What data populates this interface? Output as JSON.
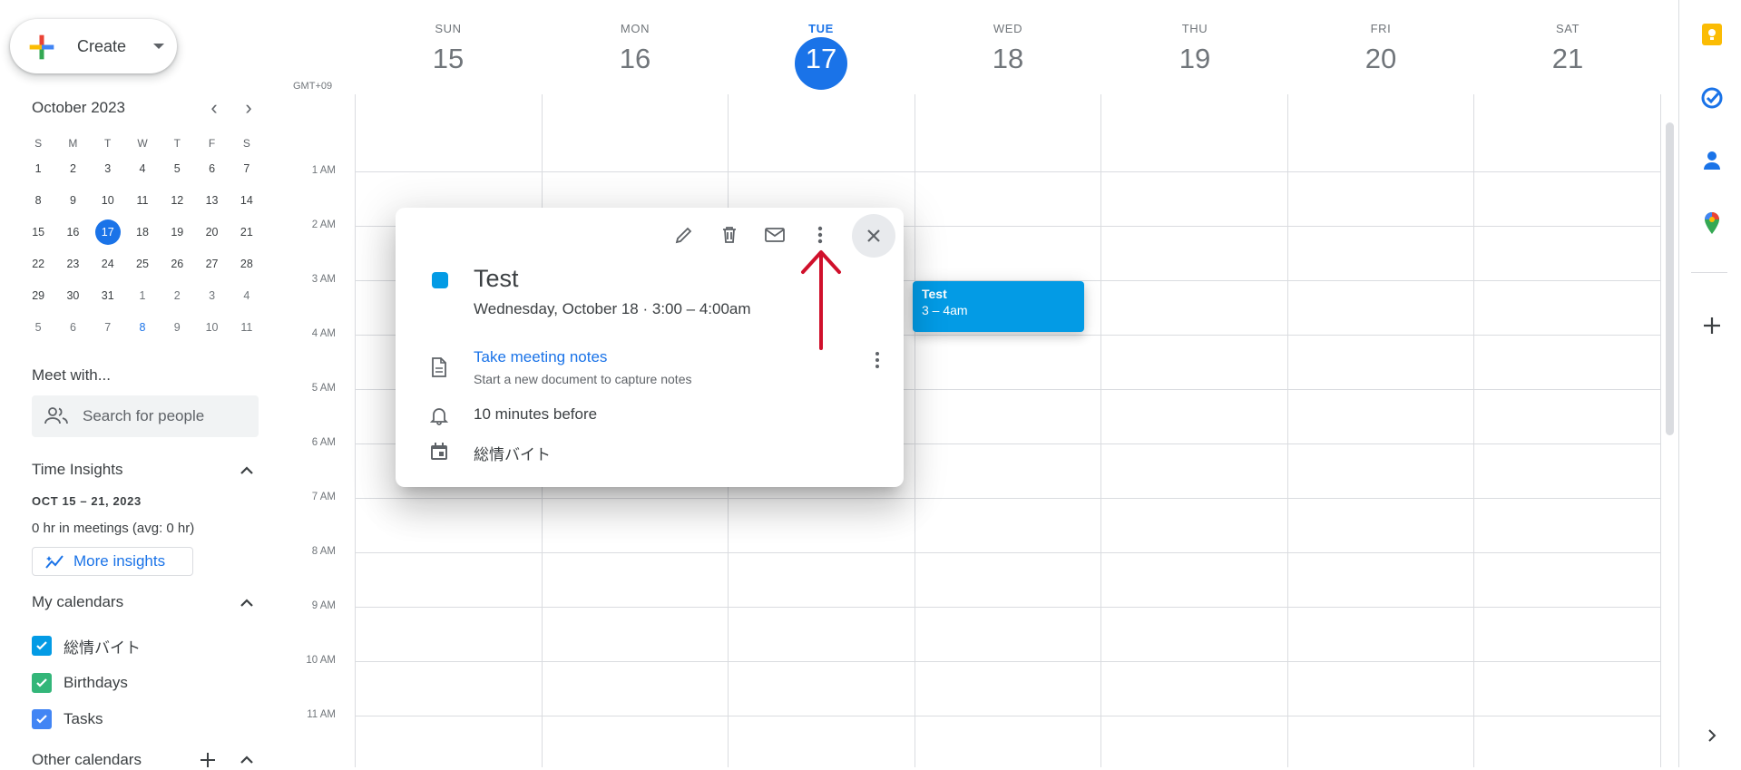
{
  "create_label": "Create",
  "mini": {
    "title": "October 2023",
    "weekdays": [
      "S",
      "M",
      "T",
      "W",
      "T",
      "F",
      "S"
    ],
    "weeks": [
      [
        "1",
        "2",
        "3",
        "4",
        "5",
        "6",
        "7"
      ],
      [
        "8",
        "9",
        "10",
        "11",
        "12",
        "13",
        "14"
      ],
      [
        "15",
        "16",
        "17",
        "18",
        "19",
        "20",
        "21"
      ],
      [
        "22",
        "23",
        "24",
        "25",
        "26",
        "27",
        "28"
      ],
      [
        "29",
        "30",
        "31",
        "1",
        "2",
        "3",
        "4"
      ],
      [
        "5",
        "6",
        "7",
        "8",
        "9",
        "10",
        "11"
      ]
    ],
    "today": "17"
  },
  "meet": {
    "title": "Meet with...",
    "placeholder": "Search for people"
  },
  "insights": {
    "title": "Time Insights",
    "range": "OCT 15 – 21, 2023",
    "hours": "0 hr in meetings (avg: 0 hr)",
    "button": "More insights"
  },
  "my_calendars": {
    "title": "My calendars",
    "items": [
      {
        "name": "総情バイト",
        "color": "#039be5"
      },
      {
        "name": "Birthdays",
        "color": "#33b679"
      },
      {
        "name": "Tasks",
        "color": "#4285f4"
      }
    ]
  },
  "other_calendars": {
    "title": "Other calendars"
  },
  "timezone": "GMT+09",
  "days": [
    {
      "dow": "SUN",
      "num": "15"
    },
    {
      "dow": "MON",
      "num": "16"
    },
    {
      "dow": "TUE",
      "num": "17",
      "today": true
    },
    {
      "dow": "WED",
      "num": "18"
    },
    {
      "dow": "THU",
      "num": "19"
    },
    {
      "dow": "FRI",
      "num": "20"
    },
    {
      "dow": "SAT",
      "num": "21"
    }
  ],
  "hours": [
    "1 AM",
    "2 AM",
    "3 AM",
    "4 AM",
    "5 AM",
    "6 AM",
    "7 AM",
    "8 AM",
    "9 AM",
    "10 AM",
    "11 AM"
  ],
  "event_chip": {
    "title": "Test",
    "time": "3 – 4am",
    "color": "#039be5"
  },
  "popup": {
    "title": "Test",
    "when": "Wednesday, October 18  ·  3:00 – 4:00am",
    "notes_link": "Take meeting notes",
    "notes_sub": "Start a new document to capture notes",
    "reminder": "10 minutes before",
    "calendar": "総情バイト"
  },
  "colors": {
    "accent": "#1a73e8",
    "event": "#039be5",
    "arrow": "#d0102b"
  }
}
